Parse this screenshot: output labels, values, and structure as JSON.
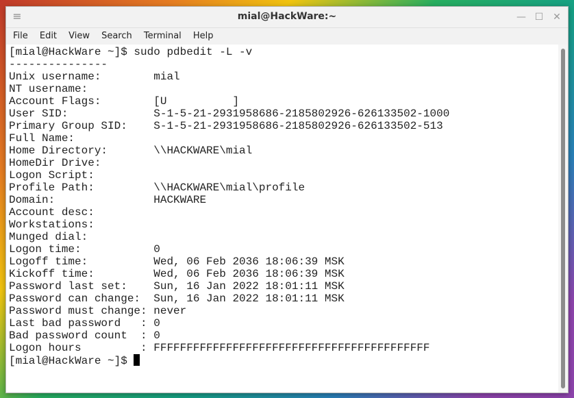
{
  "window": {
    "title": "mial@HackWare:~",
    "buttons": {
      "minimize": "—",
      "maximize": "☐",
      "close": "✕"
    }
  },
  "menu": [
    "File",
    "Edit",
    "View",
    "Search",
    "Terminal",
    "Help"
  ],
  "terminal": {
    "lines": [
      "[mial@HackWare ~]$ sudo pdbedit -L -v",
      "---------------",
      "Unix username:        mial",
      "NT username:",
      "Account Flags:        [U          ]",
      "User SID:             S-1-5-21-2931958686-2185802926-626133502-1000",
      "Primary Group SID:    S-1-5-21-2931958686-2185802926-626133502-513",
      "Full Name:",
      "Home Directory:       \\\\HACKWARE\\mial",
      "HomeDir Drive:",
      "Logon Script:",
      "Profile Path:         \\\\HACKWARE\\mial\\profile",
      "Domain:               HACKWARE",
      "Account desc:",
      "Workstations:",
      "Munged dial:",
      "Logon time:           0",
      "Logoff time:          Wed, 06 Feb 2036 18:06:39 MSK",
      "Kickoff time:         Wed, 06 Feb 2036 18:06:39 MSK",
      "Password last set:    Sun, 16 Jan 2022 18:01:11 MSK",
      "Password can change:  Sun, 16 Jan 2022 18:01:11 MSK",
      "Password must change: never",
      "Last bad password   : 0",
      "Bad password count  : 0",
      "Logon hours         : FFFFFFFFFFFFFFFFFFFFFFFFFFFFFFFFFFFFFFFFFF"
    ],
    "prompt": "[mial@HackWare ~]$ "
  }
}
